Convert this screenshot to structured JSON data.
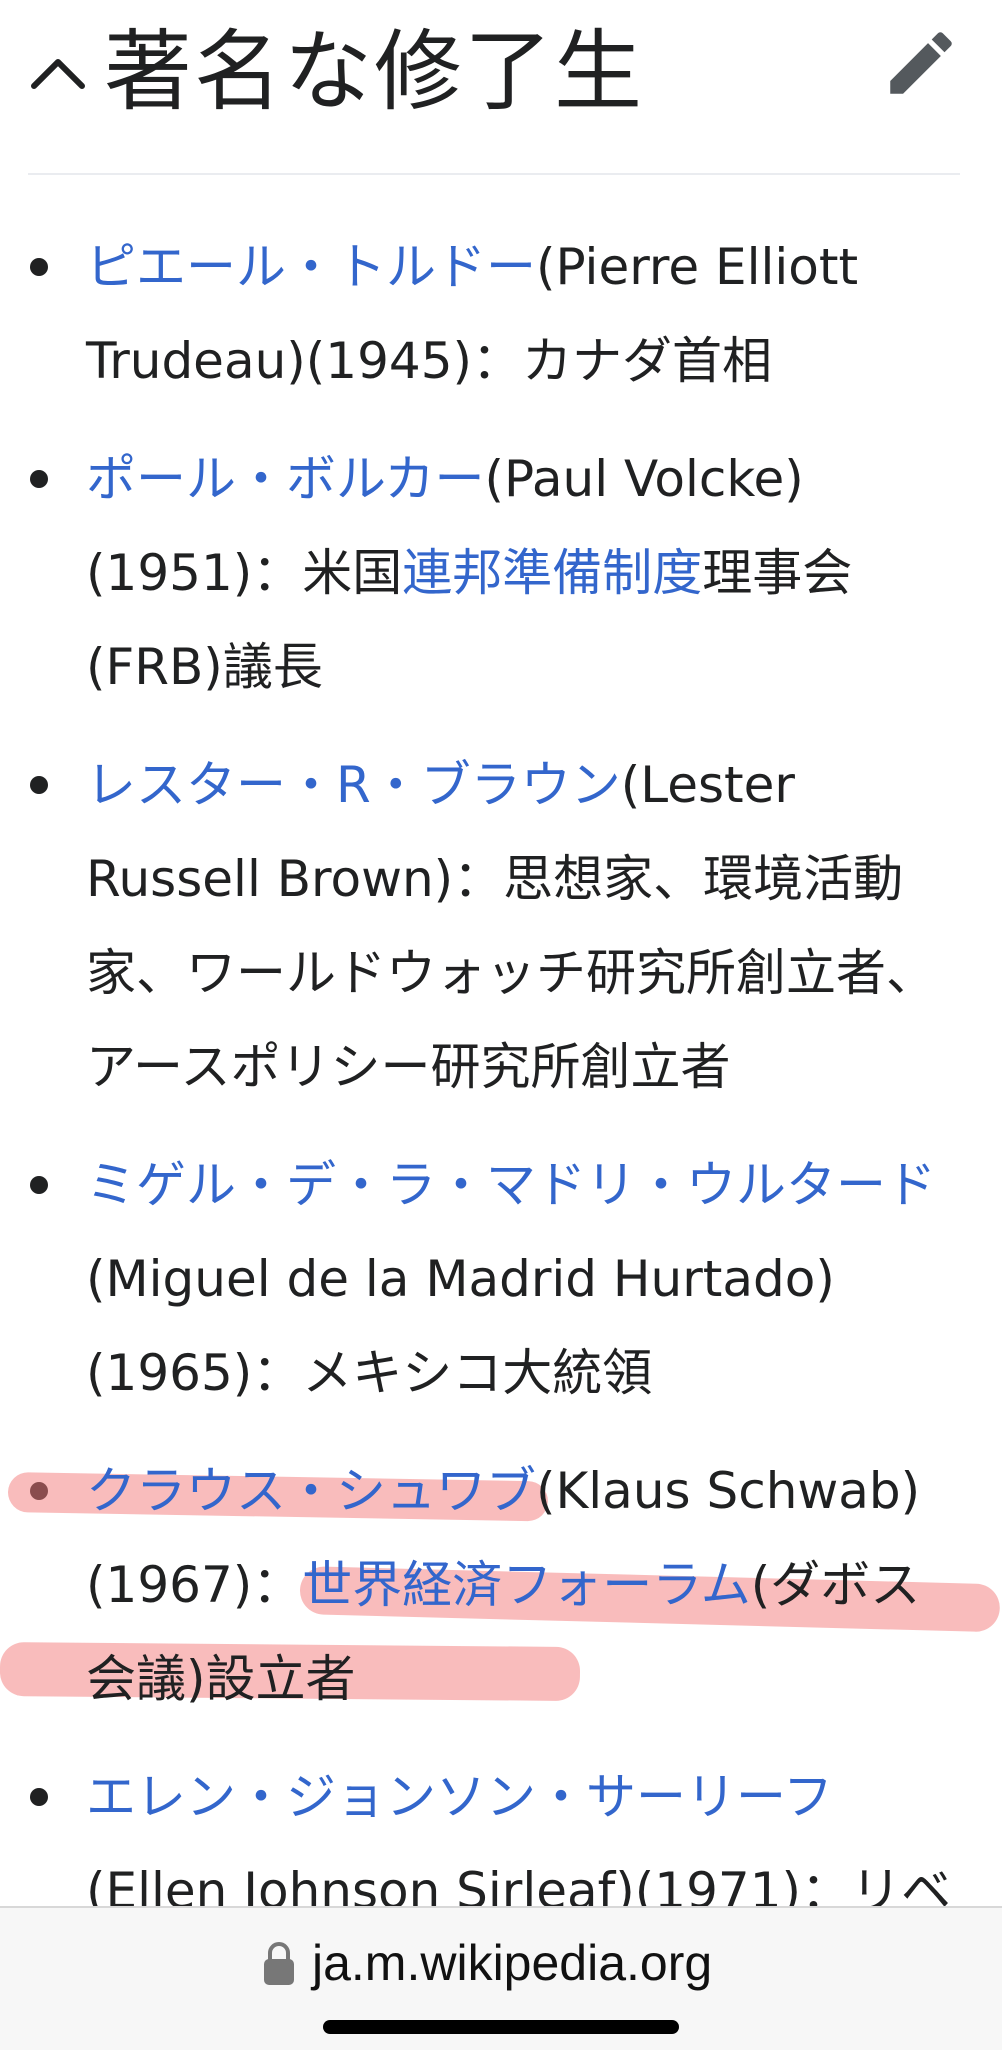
{
  "section": {
    "title": "著名な修了生"
  },
  "alumni": [
    {
      "name": "ピエール・トルドー",
      "rest": "(Pierre Elliott Trudeau)(1945)：カナダ首相"
    },
    {
      "name": "ポール・ボルカー",
      "rest1": "(Paul Volcke)(1951)：米国",
      "link2": "連邦準備制度",
      "rest2": "理事会(FRB)議長"
    },
    {
      "name": "レスター・R・ブラウン",
      "rest": "(Lester Russell Brown)：思想家、環境活動家、ワールドウォッチ研究所創立者、アースポリシー研究所創立者"
    },
    {
      "name": "ミゲル・デ・ラ・マドリ・ウルタード",
      "rest": "(Miguel de la Madrid Hurtado)(1965)：メキシコ大統領"
    },
    {
      "name": "クラウス・シュワブ",
      "rest1": "(Klaus Schwab)(1967)：",
      "link2": "世界経済フォーラム",
      "rest2": "(ダボス会議)設立者"
    },
    {
      "name": "エレン・ジョンソン・サーリーフ",
      "rest": "(Ellen Johnson Sirleaf)(1971)：リベ"
    }
  ],
  "browser": {
    "url": "ja.m.wikipedia.org"
  },
  "colors": {
    "link": "#3366cc",
    "highlight": "#f47a7a",
    "text": "#202122"
  },
  "icons": {
    "collapse": "chevron-up-icon",
    "edit": "pencil-icon",
    "secure": "lock-icon"
  }
}
